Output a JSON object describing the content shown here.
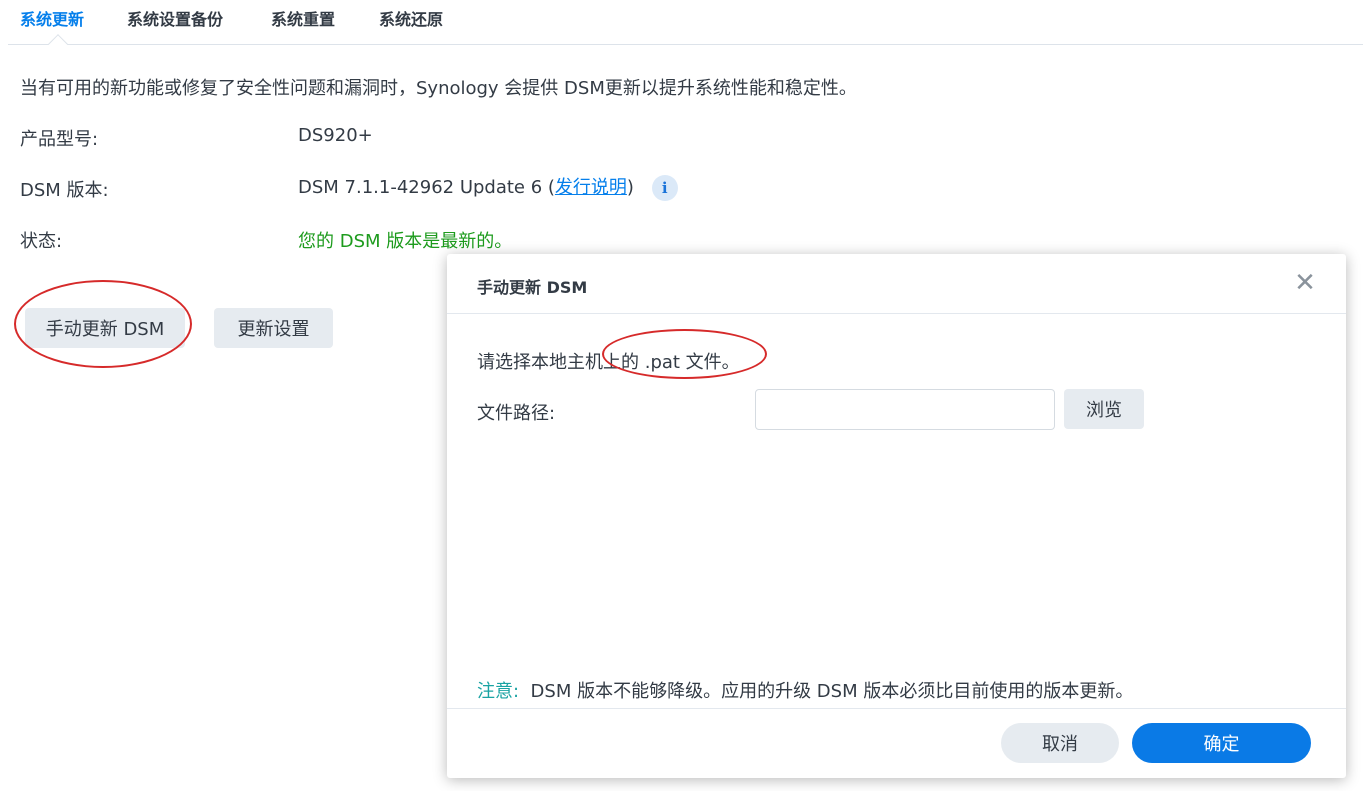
{
  "tabs": [
    {
      "label": "系统更新",
      "active": true
    },
    {
      "label": "系统设置备份",
      "active": false
    },
    {
      "label": "系统重置",
      "active": false
    },
    {
      "label": "系统还原",
      "active": false
    }
  ],
  "description": "当有可用的新功能或修复了安全性问题和漏洞时，Synology 会提供 DSM更新以提升系统性能和稳定性。",
  "info": {
    "model_label": "产品型号:",
    "model_value": "DS920+",
    "version_label": "DSM 版本:",
    "version_value_prefix": "DSM 7.1.1-42962 Update 6 (",
    "release_notes_link": "发行说明",
    "version_value_suffix": ")",
    "info_icon_glyph": "i",
    "status_label": "状态:",
    "status_value": "您的 DSM 版本是最新的。"
  },
  "buttons": {
    "manual_update": "手动更新 DSM",
    "update_settings": "更新设置"
  },
  "dialog": {
    "title": "手动更新 DSM",
    "close_glyph": "✕",
    "instruction": "请选择本地主机上的 .pat 文件。",
    "file_path_label": "文件路径:",
    "file_path_value": "",
    "browse_button": "浏览",
    "note_label": "注意:",
    "note_text": "DSM 版本不能够降级。应用的升级 DSM 版本必须比目前使用的版本更新。",
    "cancel_button": "取消",
    "ok_button": "确定"
  },
  "colors": {
    "accent": "#057feb",
    "status_ok": "#1d9b1d",
    "note": "#1aa3a3",
    "annotation": "#d62a2a"
  }
}
